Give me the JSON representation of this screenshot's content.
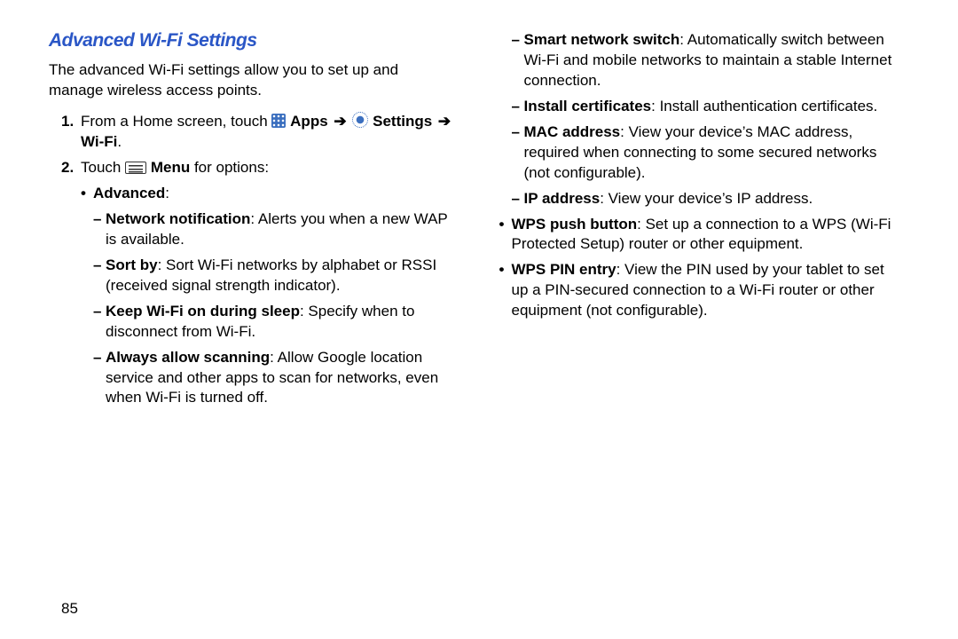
{
  "pageNumber": "85",
  "title": "Advanced Wi-Fi Settings",
  "intro": "The advanced Wi-Fi settings allow you to set up and manage wireless access points.",
  "step1": {
    "num": "1.",
    "pre": "From a Home screen, touch ",
    "apps": " Apps",
    "settings": " Settings",
    "wifi": " Wi-Fi",
    "dot": ".",
    "arrow": "➔"
  },
  "step2": {
    "num": "2.",
    "pre": "Touch ",
    "menu": " Menu",
    "post": " for options:"
  },
  "advancedLabel": "Advanced",
  "colon": ":",
  "items": {
    "netNotif": {
      "b": "Network notification",
      "t": ": Alerts you when a new WAP is available."
    },
    "sortBy": {
      "b": "Sort by",
      "t": ": Sort Wi-Fi networks by alphabet or RSSI (received signal strength indicator)."
    },
    "keepOn": {
      "b": "Keep Wi-Fi on during sleep",
      "t": ": Specify when to disconnect from Wi-Fi."
    },
    "allowScan": {
      "b": "Always allow scanning",
      "t": ": Allow Google location service and other apps to scan for networks, even when Wi-Fi is turned off."
    },
    "smartNet": {
      "b": "Smart network switch",
      "t": ": Automatically switch between Wi-Fi and mobile networks to maintain a stable Internet connection."
    },
    "installCert": {
      "b": "Install certificates",
      "t": ": Install authentication certificates."
    },
    "mac": {
      "b": "MAC address",
      "t": ": View your device’s MAC address, required when connecting to some secured networks (not configurable)."
    },
    "ip": {
      "b": "IP address",
      "t": ": View your device’s IP address."
    },
    "wpsPush": {
      "b": "WPS push button",
      "t": ": Set up a connection to a WPS (Wi-Fi Protected Setup) router or other equipment."
    },
    "wpsPin": {
      "b": "WPS PIN entry",
      "t": ": View the PIN used by your tablet to set up a PIN-secured connection to a Wi-Fi router or other equipment (not configurable)."
    }
  },
  "marks": {
    "bullet": "•",
    "dash": "–"
  }
}
